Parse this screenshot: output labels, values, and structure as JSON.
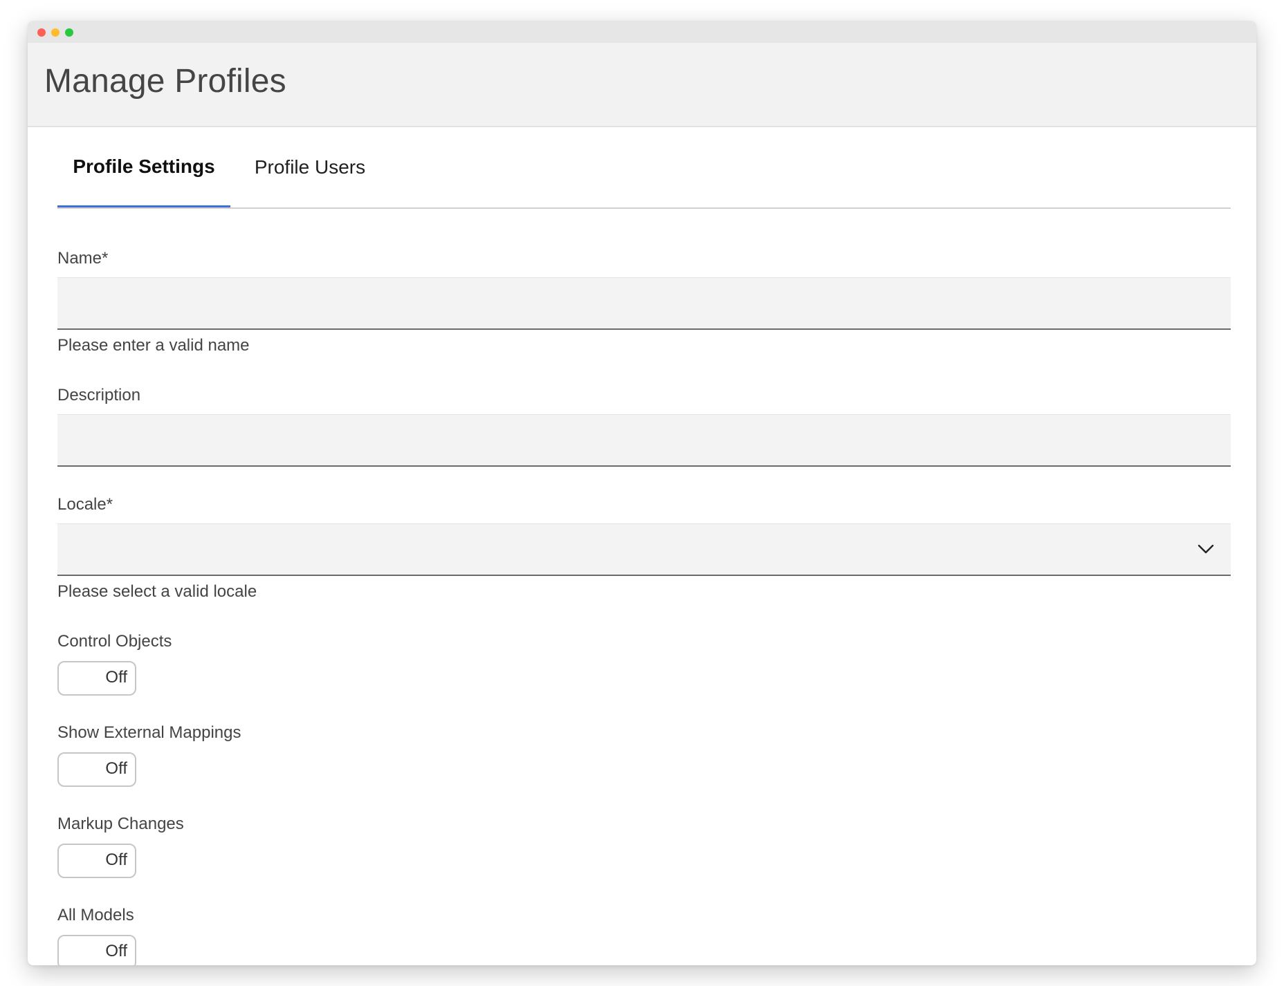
{
  "window": {
    "title": "Manage Profiles"
  },
  "tabs": [
    {
      "label": "Profile Settings",
      "active": true
    },
    {
      "label": "Profile Users",
      "active": false
    }
  ],
  "form": {
    "name": {
      "label": "Name*",
      "value": "",
      "helper": "Please enter a valid name"
    },
    "description": {
      "label": "Description",
      "value": ""
    },
    "locale": {
      "label": "Locale*",
      "selected": "",
      "helper": "Please select a valid locale",
      "icon": "chevron-down-icon"
    },
    "toggles": [
      {
        "label": "Control Objects",
        "state": "Off"
      },
      {
        "label": "Show External Mappings",
        "state": "Off"
      },
      {
        "label": "Markup Changes",
        "state": "Off"
      },
      {
        "label": "All Models",
        "state": "Off"
      }
    ]
  },
  "colors": {
    "active_tab_underline": "#3f6fd8",
    "header_background": "#f2f2f2",
    "input_background": "#f3f3f3"
  }
}
